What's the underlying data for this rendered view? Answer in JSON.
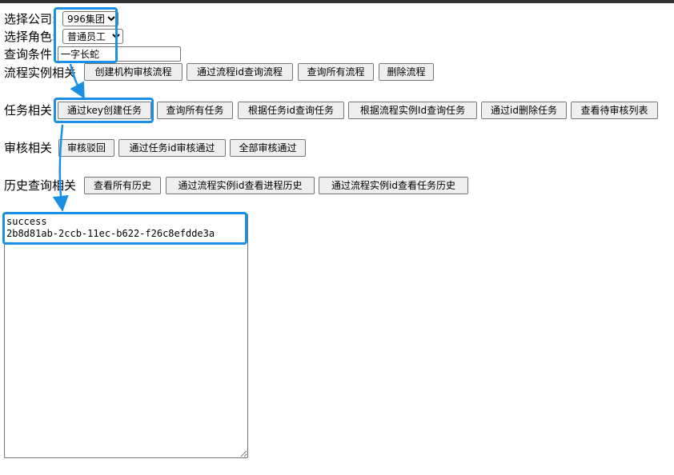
{
  "form": {
    "company_label": "选择公司:",
    "company_selected": "996集团",
    "role_label": "选择角色:",
    "role_selected": "普通员工",
    "query_label": "查询条件",
    "query_value": "一字长蛇"
  },
  "process": {
    "label": "流程实例相关",
    "buttons": [
      "创建机构审核流程",
      "通过流程id查询流程",
      "查询所有流程",
      "删除流程"
    ]
  },
  "task": {
    "label": "任务相关",
    "buttons": [
      "通过key创建任务",
      "查询所有任务",
      "根据任务id查询任务",
      "根据流程实例Id查询任务",
      "通过id删除任务",
      "查看待审核列表"
    ]
  },
  "review": {
    "label": "审核相关",
    "buttons": [
      "审核驳回",
      "通过任务id审核通过",
      "全部审核通过"
    ]
  },
  "history": {
    "label": "历史查询相关",
    "buttons": [
      "查看所有历史",
      "通过流程实例id查看进程历史",
      "通过流程实例id查看任务历史"
    ]
  },
  "output": {
    "text": "success\n2b8d81ab-2ccb-11ec-b622-f26c8efdde3a"
  },
  "theme": {
    "highlight_color": "#1a8fe3"
  }
}
